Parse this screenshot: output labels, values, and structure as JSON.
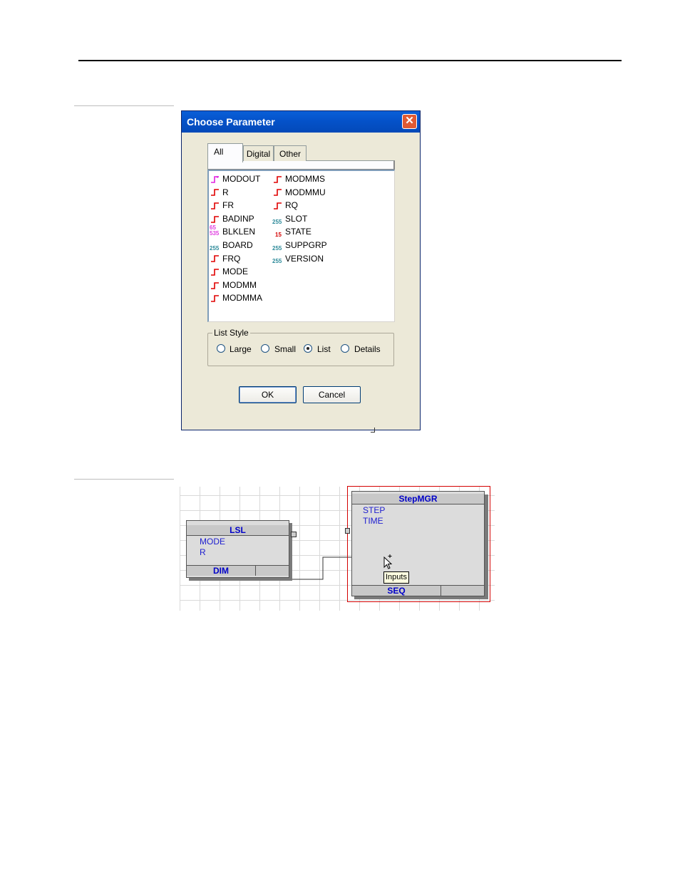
{
  "dialog": {
    "title": "Choose Parameter",
    "close_icon": "close-icon",
    "tabs": [
      {
        "label": "All"
      },
      {
        "label": "Digital"
      },
      {
        "label": "Other"
      }
    ],
    "parameters_col1": [
      {
        "label": "MODOUT",
        "icon": "step-out-icon"
      },
      {
        "label": "R",
        "icon": "step-icon"
      },
      {
        "label": "FR",
        "icon": "step-icon"
      },
      {
        "label": "BADINP",
        "icon": "step-icon"
      },
      {
        "label": "BLKLEN",
        "icon": "num-65535-icon",
        "icon_text_top": "65",
        "icon_text_bottom": "535"
      },
      {
        "label": "BOARD",
        "icon": "num-255-icon",
        "icon_text": "255"
      },
      {
        "label": "FRQ",
        "icon": "step-icon"
      },
      {
        "label": "MODE",
        "icon": "step-icon"
      },
      {
        "label": "MODMM",
        "icon": "step-icon"
      },
      {
        "label": "MODMMA",
        "icon": "step-icon"
      }
    ],
    "parameters_col2": [
      {
        "label": "MODMMS",
        "icon": "step-icon"
      },
      {
        "label": "MODMMU",
        "icon": "step-icon"
      },
      {
        "label": "RQ",
        "icon": "step-icon"
      },
      {
        "label": "SLOT",
        "icon": "num-255-icon",
        "icon_text": "255"
      },
      {
        "label": "STATE",
        "icon": "num-15-icon",
        "icon_text": "15"
      },
      {
        "label": "SUPPGRP",
        "icon": "num-255-icon",
        "icon_text": "255"
      },
      {
        "label": "VERSION",
        "icon": "num-255-icon",
        "icon_text": "255"
      }
    ],
    "list_style": {
      "title": "List Style",
      "options": [
        {
          "label": "Large",
          "selected": false
        },
        {
          "label": "Small",
          "selected": false
        },
        {
          "label": "List",
          "selected": true
        },
        {
          "label": "Details",
          "selected": false
        }
      ]
    },
    "ok_label": "OK",
    "cancel_label": "Cancel"
  },
  "diagram": {
    "lsl_block": {
      "title": "LSL",
      "pins": [
        "MODE",
        "R"
      ],
      "footer": "DIM"
    },
    "stepmgr_block": {
      "title": "StepMGR",
      "pins": [
        "STEP",
        "TIME"
      ],
      "footer": "SEQ"
    },
    "tooltip": "Inputs",
    "colors": {
      "block_text": "#0000c8",
      "selection": "#d40000",
      "step_icon": "#e00000"
    }
  }
}
